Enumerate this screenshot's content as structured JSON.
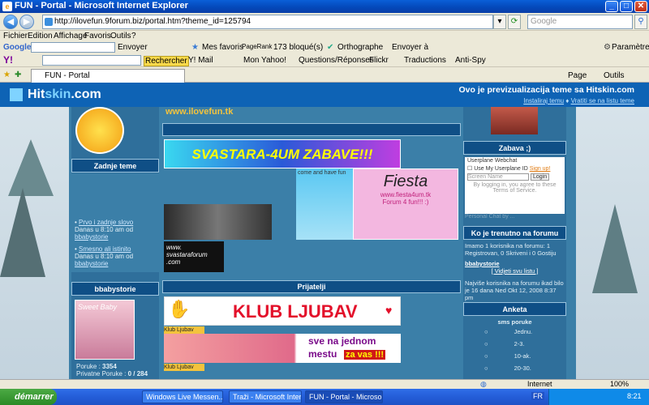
{
  "window": {
    "title": "FUN - Portal - Microsoft Internet Explorer"
  },
  "address": {
    "url": "http://ilovefun.9forum.biz/portal.htm?theme_id=125794",
    "search_placeholder": "Google"
  },
  "menu": [
    "Fichier",
    "Edition",
    "Affichage",
    "Favoris",
    "Outils",
    "?"
  ],
  "google_toolbar": {
    "label": "Google",
    "search_label": "Envoyer",
    "favorites": "Mes favoris",
    "pagerank": "PageRank",
    "blocked": "173 bloqué(s)",
    "spelling": "Orthographe",
    "send": "Envoyer à",
    "settings": "Paramètres"
  },
  "yahoo_toolbar": {
    "search_btn": "Rechercher",
    "mail": "Y! Mail",
    "myyahoo": "Mon Yahoo!",
    "qa": "Questions/Réponses",
    "flickr": "Flickr",
    "translate": "Traductions",
    "antispy": "Anti-Spy"
  },
  "tab": {
    "label": "FUN - Portal",
    "page_menu": "Page",
    "tools_menu": "Outils"
  },
  "hitskin": {
    "logo_pre": "Hit",
    "logo_mid": "skin",
    "logo_post": ".com",
    "message": "Ovo je previzualizacija teme sa Hitskin.com",
    "link_install": "Instaliraj temu",
    "link_return": "Vratiti se na listu teme"
  },
  "left": {
    "recent_title": "Zadnje teme",
    "recent": [
      {
        "title": "Prvo i zadnje slovo",
        "meta": "Danas u 8:10 am od",
        "user": "bbabystorie"
      },
      {
        "title": "Smesno ali istinito",
        "meta": "Danas u 8:10 am od",
        "user": "bbabystorie"
      }
    ],
    "user_title": "bbabystorie",
    "avatar_text": "Sweet Baby",
    "posts_label": "Poruke :",
    "posts": "3354",
    "pm_label": "Privatne Poruke :",
    "pm": "0 / 284"
  },
  "center": {
    "banner1": "SVASTARA-4UM ZABAVE!!!",
    "banner_fiesta": "Fiesta",
    "banner_fiesta_url": "www.fiesta4um.tk",
    "banner_fiesta_sub": "Forum 4 fun!!! :)",
    "banner_come": "come and have fun",
    "banner_site": "www. svastaraforum .com",
    "partners_title": "Prijatelji",
    "klub": "KLUB LJUBAV",
    "klub_tag": "Klub Ljubav",
    "klub_slogan1": "sve na jednom",
    "klub_slogan2": "mestu",
    "klub_slogan3": "za vas !!!",
    "klub_tag2": "Klub Ljubav",
    "top_url": "www.ilovefun.tk"
  },
  "right": {
    "chat_title": "Zabava ;)",
    "chat_header": "Userplane Webchat",
    "chat_remember": "Use My Userplane ID",
    "chat_signup": "Sign up!",
    "chat_input": "Screen Name",
    "chat_login": "Login",
    "chat_terms": "By logging in, you agree to these Terms of Service.",
    "chat_powered": "Personal Chat by ...",
    "online_title": "Ko je trenutno na forumu",
    "online_text": "Imamo 1 korisnika na forumu: 1 Registrovan, 0 Skriveni i 0 Gostiju",
    "online_user": "bbabystorie",
    "online_list": "[ Vidjeti svu listu ]",
    "record_text": "Najviše korisnika na forumu ikad bilo je 16 dana Ned Okt 12, 2008 8:37 pm",
    "poll_title": "Anketa",
    "poll_question": "sms poruke",
    "poll_options": [
      "Jednu.",
      "2-3.",
      "10-ak.",
      "20-30."
    ]
  },
  "status": {
    "zone": "Internet",
    "zoom": "100%"
  },
  "taskbar": {
    "start": "démarrer",
    "items": [
      "Windows Live Messen...",
      "Traži - Microsoft Inter...",
      "FUN - Portal - Microso..."
    ],
    "lang": "FR",
    "clock": "8:21"
  }
}
